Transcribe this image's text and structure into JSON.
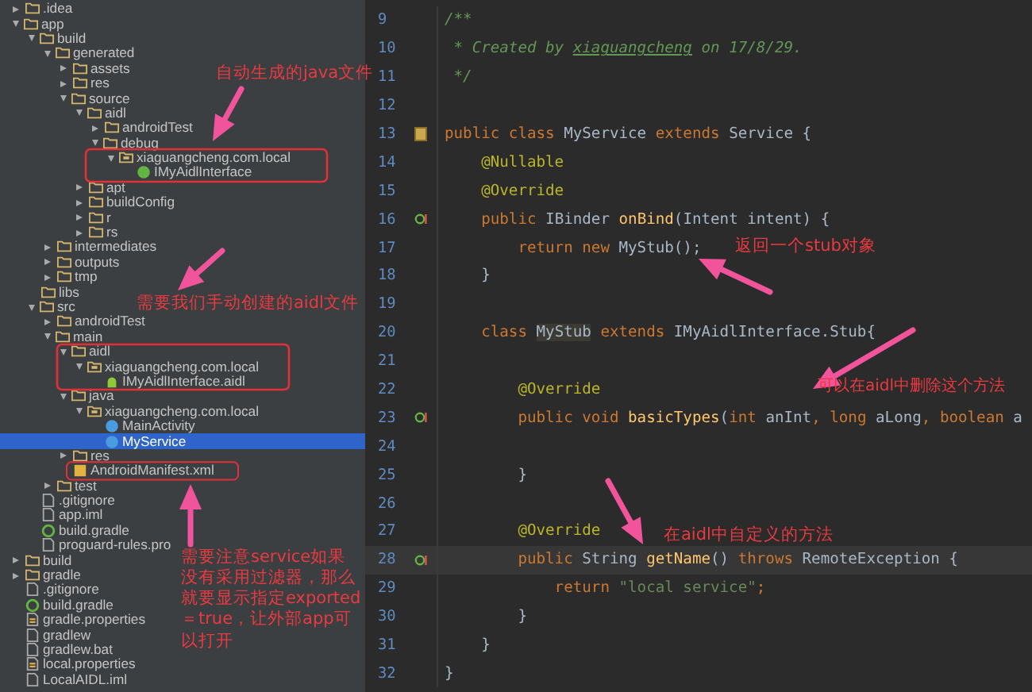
{
  "project_tree": [
    {
      "name": ".idea",
      "kind": "folder",
      "expanded": false,
      "selected": false
    },
    {
      "name": "app",
      "kind": "folder",
      "expanded": true,
      "selected": false,
      "children": [
        {
          "name": "build",
          "kind": "folder",
          "expanded": true,
          "selected": false,
          "children": [
            {
              "name": "generated",
              "kind": "folder",
              "expanded": true,
              "selected": false,
              "children": [
                {
                  "name": "assets",
                  "kind": "folder",
                  "expanded": false,
                  "selected": false
                },
                {
                  "name": "res",
                  "kind": "folder",
                  "expanded": false,
                  "selected": false
                },
                {
                  "name": "source",
                  "kind": "folder",
                  "expanded": true,
                  "selected": false,
                  "children": [
                    {
                      "name": "aidl",
                      "kind": "folder",
                      "expanded": true,
                      "selected": false,
                      "children": [
                        {
                          "name": "androidTest",
                          "kind": "folder",
                          "expanded": false,
                          "selected": false
                        },
                        {
                          "name": "debug",
                          "kind": "folder",
                          "expanded": true,
                          "selected": false,
                          "children": [
                            {
                              "name": "xiaguangcheng.com.local",
                              "kind": "package",
                              "expanded": true,
                              "selected": false,
                              "children": [
                                {
                                  "name": "IMyAidlInterface",
                                  "kind": "interface",
                                  "selected": false
                                }
                              ]
                            }
                          ]
                        }
                      ]
                    },
                    {
                      "name": "apt",
                      "kind": "folder",
                      "expanded": false,
                      "selected": false
                    },
                    {
                      "name": "buildConfig",
                      "kind": "folder",
                      "expanded": false,
                      "selected": false
                    },
                    {
                      "name": "r",
                      "kind": "folder",
                      "expanded": false,
                      "selected": false
                    },
                    {
                      "name": "rs",
                      "kind": "folder",
                      "expanded": false,
                      "selected": false
                    }
                  ]
                }
              ]
            },
            {
              "name": "intermediates",
              "kind": "folder",
              "expanded": false,
              "selected": false
            },
            {
              "name": "outputs",
              "kind": "folder",
              "expanded": false,
              "selected": false
            },
            {
              "name": "tmp",
              "kind": "folder",
              "expanded": false,
              "selected": false
            }
          ]
        },
        {
          "name": "libs",
          "kind": "folder",
          "selected": false
        },
        {
          "name": "src",
          "kind": "folder",
          "expanded": true,
          "selected": false,
          "children": [
            {
              "name": "androidTest",
              "kind": "folder",
              "expanded": false,
              "selected": false
            },
            {
              "name": "main",
              "kind": "folder",
              "expanded": true,
              "selected": false,
              "children": [
                {
                  "name": "aidl",
                  "kind": "folder",
                  "expanded": true,
                  "selected": false,
                  "children": [
                    {
                      "name": "xiaguangcheng.com.local",
                      "kind": "package",
                      "expanded": true,
                      "selected": false,
                      "children": [
                        {
                          "name": "IMyAidlInterface.aidl",
                          "kind": "aidl",
                          "selected": false
                        }
                      ]
                    }
                  ]
                },
                {
                  "name": "java",
                  "kind": "folder",
                  "expanded": true,
                  "selected": false,
                  "children": [
                    {
                      "name": "xiaguangcheng.com.local",
                      "kind": "package",
                      "expanded": true,
                      "selected": false,
                      "children": [
                        {
                          "name": "MainActivity",
                          "kind": "class",
                          "selected": false
                        },
                        {
                          "name": "MyService",
                          "kind": "class",
                          "selected": true
                        }
                      ]
                    }
                  ]
                },
                {
                  "name": "res",
                  "kind": "folder",
                  "expanded": false,
                  "selected": false
                },
                {
                  "name": "AndroidManifest.xml",
                  "kind": "manifest",
                  "selected": false
                }
              ]
            },
            {
              "name": "test",
              "kind": "folder",
              "expanded": false,
              "selected": false
            }
          ]
        },
        {
          "name": ".gitignore",
          "kind": "file",
          "selected": false
        },
        {
          "name": "app.iml",
          "kind": "file",
          "selected": false
        },
        {
          "name": "build.gradle",
          "kind": "gradle",
          "selected": false
        },
        {
          "name": "proguard-rules.pro",
          "kind": "file",
          "selected": false
        }
      ]
    },
    {
      "name": "build",
      "kind": "folder",
      "expanded": false,
      "selected": false
    },
    {
      "name": "gradle",
      "kind": "folder",
      "expanded": false,
      "selected": false
    },
    {
      "name": ".gitignore",
      "kind": "file",
      "selected": false
    },
    {
      "name": "build.gradle",
      "kind": "gradle",
      "selected": false
    },
    {
      "name": "gradle.properties",
      "kind": "properties",
      "selected": false
    },
    {
      "name": "gradlew",
      "kind": "file",
      "selected": false
    },
    {
      "name": "gradlew.bat",
      "kind": "file",
      "selected": false
    },
    {
      "name": "local.properties",
      "kind": "properties",
      "selected": false
    },
    {
      "name": "LocalAIDL.iml",
      "kind": "file",
      "selected": false
    }
  ],
  "editor": {
    "lines": [
      {
        "number": "9",
        "kind": "plain",
        "current": false,
        "tokens": [
          {
            "kind": "comment",
            "text": "/**"
          }
        ]
      },
      {
        "number": "10",
        "kind": "plain",
        "current": false,
        "tokens": [
          {
            "kind": "comment",
            "text": " * Created by "
          },
          {
            "kind": "comment_link",
            "text": "xiaguangcheng"
          },
          {
            "kind": "comment",
            "text": " on 17/8/29."
          }
        ]
      },
      {
        "number": "11",
        "kind": "plain",
        "current": false,
        "tokens": [
          {
            "kind": "comment",
            "text": " */"
          }
        ]
      },
      {
        "number": "12",
        "kind": "plain",
        "current": false
      },
      {
        "number": "13",
        "kind": "class_marker",
        "current": false,
        "tokens": [
          {
            "kind": "keyword",
            "text": "public class "
          },
          {
            "kind": "plain",
            "text": "MyService "
          },
          {
            "kind": "keyword",
            "text": "extends "
          },
          {
            "kind": "plain",
            "text": "Service {"
          }
        ]
      },
      {
        "number": "14",
        "kind": "plain",
        "current": false,
        "tokens": [
          {
            "kind": "annotation",
            "text": "    @Nullable"
          }
        ]
      },
      {
        "number": "15",
        "kind": "plain",
        "current": false,
        "tokens": [
          {
            "kind": "annotation",
            "text": "    @Override"
          }
        ]
      },
      {
        "number": "16",
        "kind": "override_marker",
        "current": false,
        "tokens": [
          {
            "kind": "keyword",
            "text": "    public "
          },
          {
            "kind": "plain",
            "text": "IBinder "
          },
          {
            "kind": "method",
            "text": "onBind"
          },
          {
            "kind": "plain",
            "text": "(Intent intent) {"
          }
        ]
      },
      {
        "number": "17",
        "kind": "plain",
        "current": false,
        "tokens": [
          {
            "kind": "keyword",
            "text": "        return new "
          },
          {
            "kind": "plain",
            "text": "MyStub();"
          }
        ]
      },
      {
        "number": "18",
        "kind": "plain",
        "current": false,
        "tokens": [
          {
            "kind": "plain",
            "text": "    }"
          }
        ]
      },
      {
        "number": "19",
        "kind": "plain",
        "current": false
      },
      {
        "number": "20",
        "kind": "plain",
        "current": false,
        "tokens": [
          {
            "kind": "keyword",
            "text": "    class "
          },
          {
            "kind": "usage",
            "text": "MyStub"
          },
          {
            "kind": "keyword",
            "text": " extends "
          },
          {
            "kind": "plain",
            "text": "IMyAidlInterface.Stub{"
          }
        ]
      },
      {
        "number": "21",
        "kind": "plain",
        "current": false
      },
      {
        "number": "22",
        "kind": "plain",
        "current": false,
        "tokens": [
          {
            "kind": "annotation",
            "text": "        @Override"
          }
        ]
      },
      {
        "number": "23",
        "kind": "override_marker",
        "current": false,
        "tokens": [
          {
            "kind": "keyword",
            "text": "        public void "
          },
          {
            "kind": "method",
            "text": "basicTypes"
          },
          {
            "kind": "plain",
            "text": "("
          },
          {
            "kind": "keyword",
            "text": "int "
          },
          {
            "kind": "plain",
            "text": "anInt"
          },
          {
            "kind": "keyword",
            "text": ", long "
          },
          {
            "kind": "plain",
            "text": "aLong"
          },
          {
            "kind": "keyword",
            "text": ", boolean "
          },
          {
            "kind": "plain",
            "text": "a"
          }
        ]
      },
      {
        "number": "24",
        "kind": "plain",
        "current": false
      },
      {
        "number": "25",
        "kind": "plain",
        "current": false,
        "tokens": [
          {
            "kind": "plain",
            "text": "        }"
          }
        ]
      },
      {
        "number": "26",
        "kind": "plain",
        "current": false
      },
      {
        "number": "27",
        "kind": "plain",
        "current": false,
        "tokens": [
          {
            "kind": "annotation",
            "text": "        @Override"
          }
        ]
      },
      {
        "number": "28",
        "kind": "override_marker",
        "current": true,
        "tokens": [
          {
            "kind": "keyword",
            "text": "        public "
          },
          {
            "kind": "plain",
            "text": "String "
          },
          {
            "kind": "method",
            "text": "getName"
          },
          {
            "kind": "plain",
            "text": "() "
          },
          {
            "kind": "keyword",
            "text": "throws "
          },
          {
            "kind": "plain",
            "text": "RemoteException {"
          }
        ]
      },
      {
        "number": "29",
        "kind": "plain",
        "current": false,
        "tokens": [
          {
            "kind": "keyword",
            "text": "            return "
          },
          {
            "kind": "string",
            "text": "\"local service\""
          },
          {
            "kind": "keyword",
            "text": ";"
          }
        ]
      },
      {
        "number": "30",
        "kind": "plain",
        "current": false,
        "tokens": [
          {
            "kind": "plain",
            "text": "        }"
          }
        ]
      },
      {
        "number": "31",
        "kind": "plain",
        "current": false,
        "tokens": [
          {
            "kind": "plain",
            "text": "    }"
          }
        ]
      },
      {
        "number": "32",
        "kind": "plain",
        "current": false,
        "tokens": [
          {
            "kind": "plain",
            "text": "}"
          }
        ]
      }
    ]
  },
  "annotations": [
    {
      "text": "自动生成的java文件"
    },
    {
      "text": "需要我们手动创建的aidl文件"
    },
    {
      "text": "返回一个stub对象"
    },
    {
      "text": "可以在aidl中删除这个方法"
    },
    {
      "text": "在aidl中自定义的方法"
    },
    {
      "text": "需要注意service如果没有采用过滤器，那么就要显示指定exported＝true，让外部app可以打开"
    }
  ]
}
